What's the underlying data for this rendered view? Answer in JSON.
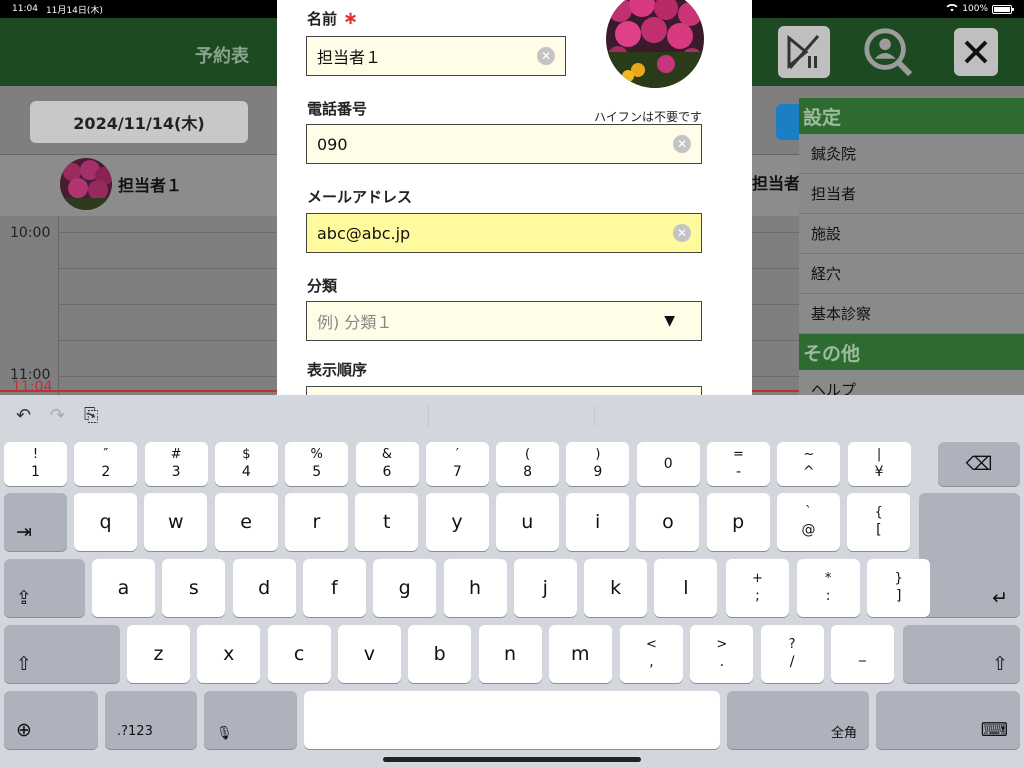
{
  "status": {
    "time": "11:04",
    "date": "11月14日(木)",
    "battery": "100%",
    "battery_level": 1.0
  },
  "app": {
    "title": "予約表",
    "date": "2024/11/14(木)",
    "staff": [
      "担当者１",
      "担当者"
    ],
    "times": [
      "10:00",
      "11:00"
    ],
    "now": "11:04",
    "settings": {
      "header": "設定",
      "items": [
        "鍼灸院",
        "担当者",
        "施設",
        "経穴",
        "基本診察"
      ],
      "other_header": "その他",
      "other_items": [
        "ヘルプ"
      ]
    }
  },
  "form": {
    "name_label": "名前",
    "required_mark": "∗",
    "name_value": "担当者１",
    "phone_label": "電話番号",
    "phone_hint": "ハイフンは不要です",
    "phone_value": "090",
    "email_label": "メールアドレス",
    "email_value": "abc@abc.jp",
    "category_label": "分類",
    "category_placeholder": "例) 分類１",
    "order_label": "表示順序"
  },
  "keyboard": {
    "row1": [
      [
        "!",
        "1"
      ],
      [
        "″",
        "2"
      ],
      [
        "#",
        "3"
      ],
      [
        "$",
        "4"
      ],
      [
        "%",
        "5"
      ],
      [
        "&",
        "6"
      ],
      [
        "′",
        "7"
      ],
      [
        "(",
        "8"
      ],
      [
        ")",
        "9"
      ],
      [
        "",
        "0"
      ],
      [
        "=",
        "-"
      ],
      [
        "~",
        "^"
      ],
      [
        "|",
        "¥"
      ]
    ],
    "row2": [
      "q",
      "w",
      "e",
      "r",
      "t",
      "y",
      "u",
      "i",
      "o",
      "p"
    ],
    "row2_extra": [
      [
        "`",
        "@"
      ],
      [
        "{",
        "["
      ]
    ],
    "row3": [
      "a",
      "s",
      "d",
      "f",
      "g",
      "h",
      "j",
      "k",
      "l"
    ],
    "row3_extra": [
      [
        "+",
        ";"
      ],
      [
        "*",
        ":"
      ],
      [
        "}",
        "]"
      ]
    ],
    "row4": [
      "z",
      "x",
      "c",
      "v",
      "b",
      "n",
      "m"
    ],
    "row4_extra": [
      [
        "<",
        ","
      ],
      [
        ">",
        "."
      ],
      [
        "?",
        "/"
      ],
      [
        "",
        "_"
      ]
    ],
    "numbers_label": ".?123",
    "zenkaku_label": "全角",
    "icons": {
      "undo": "↶",
      "redo": "↷",
      "paste": "⎘",
      "backspace": "⌫",
      "tab": "⇥",
      "caps": "⇪",
      "return": "↵",
      "shift": "⇧",
      "globe": "⊕",
      "mic": "🎙",
      "hide": "⌨"
    }
  }
}
